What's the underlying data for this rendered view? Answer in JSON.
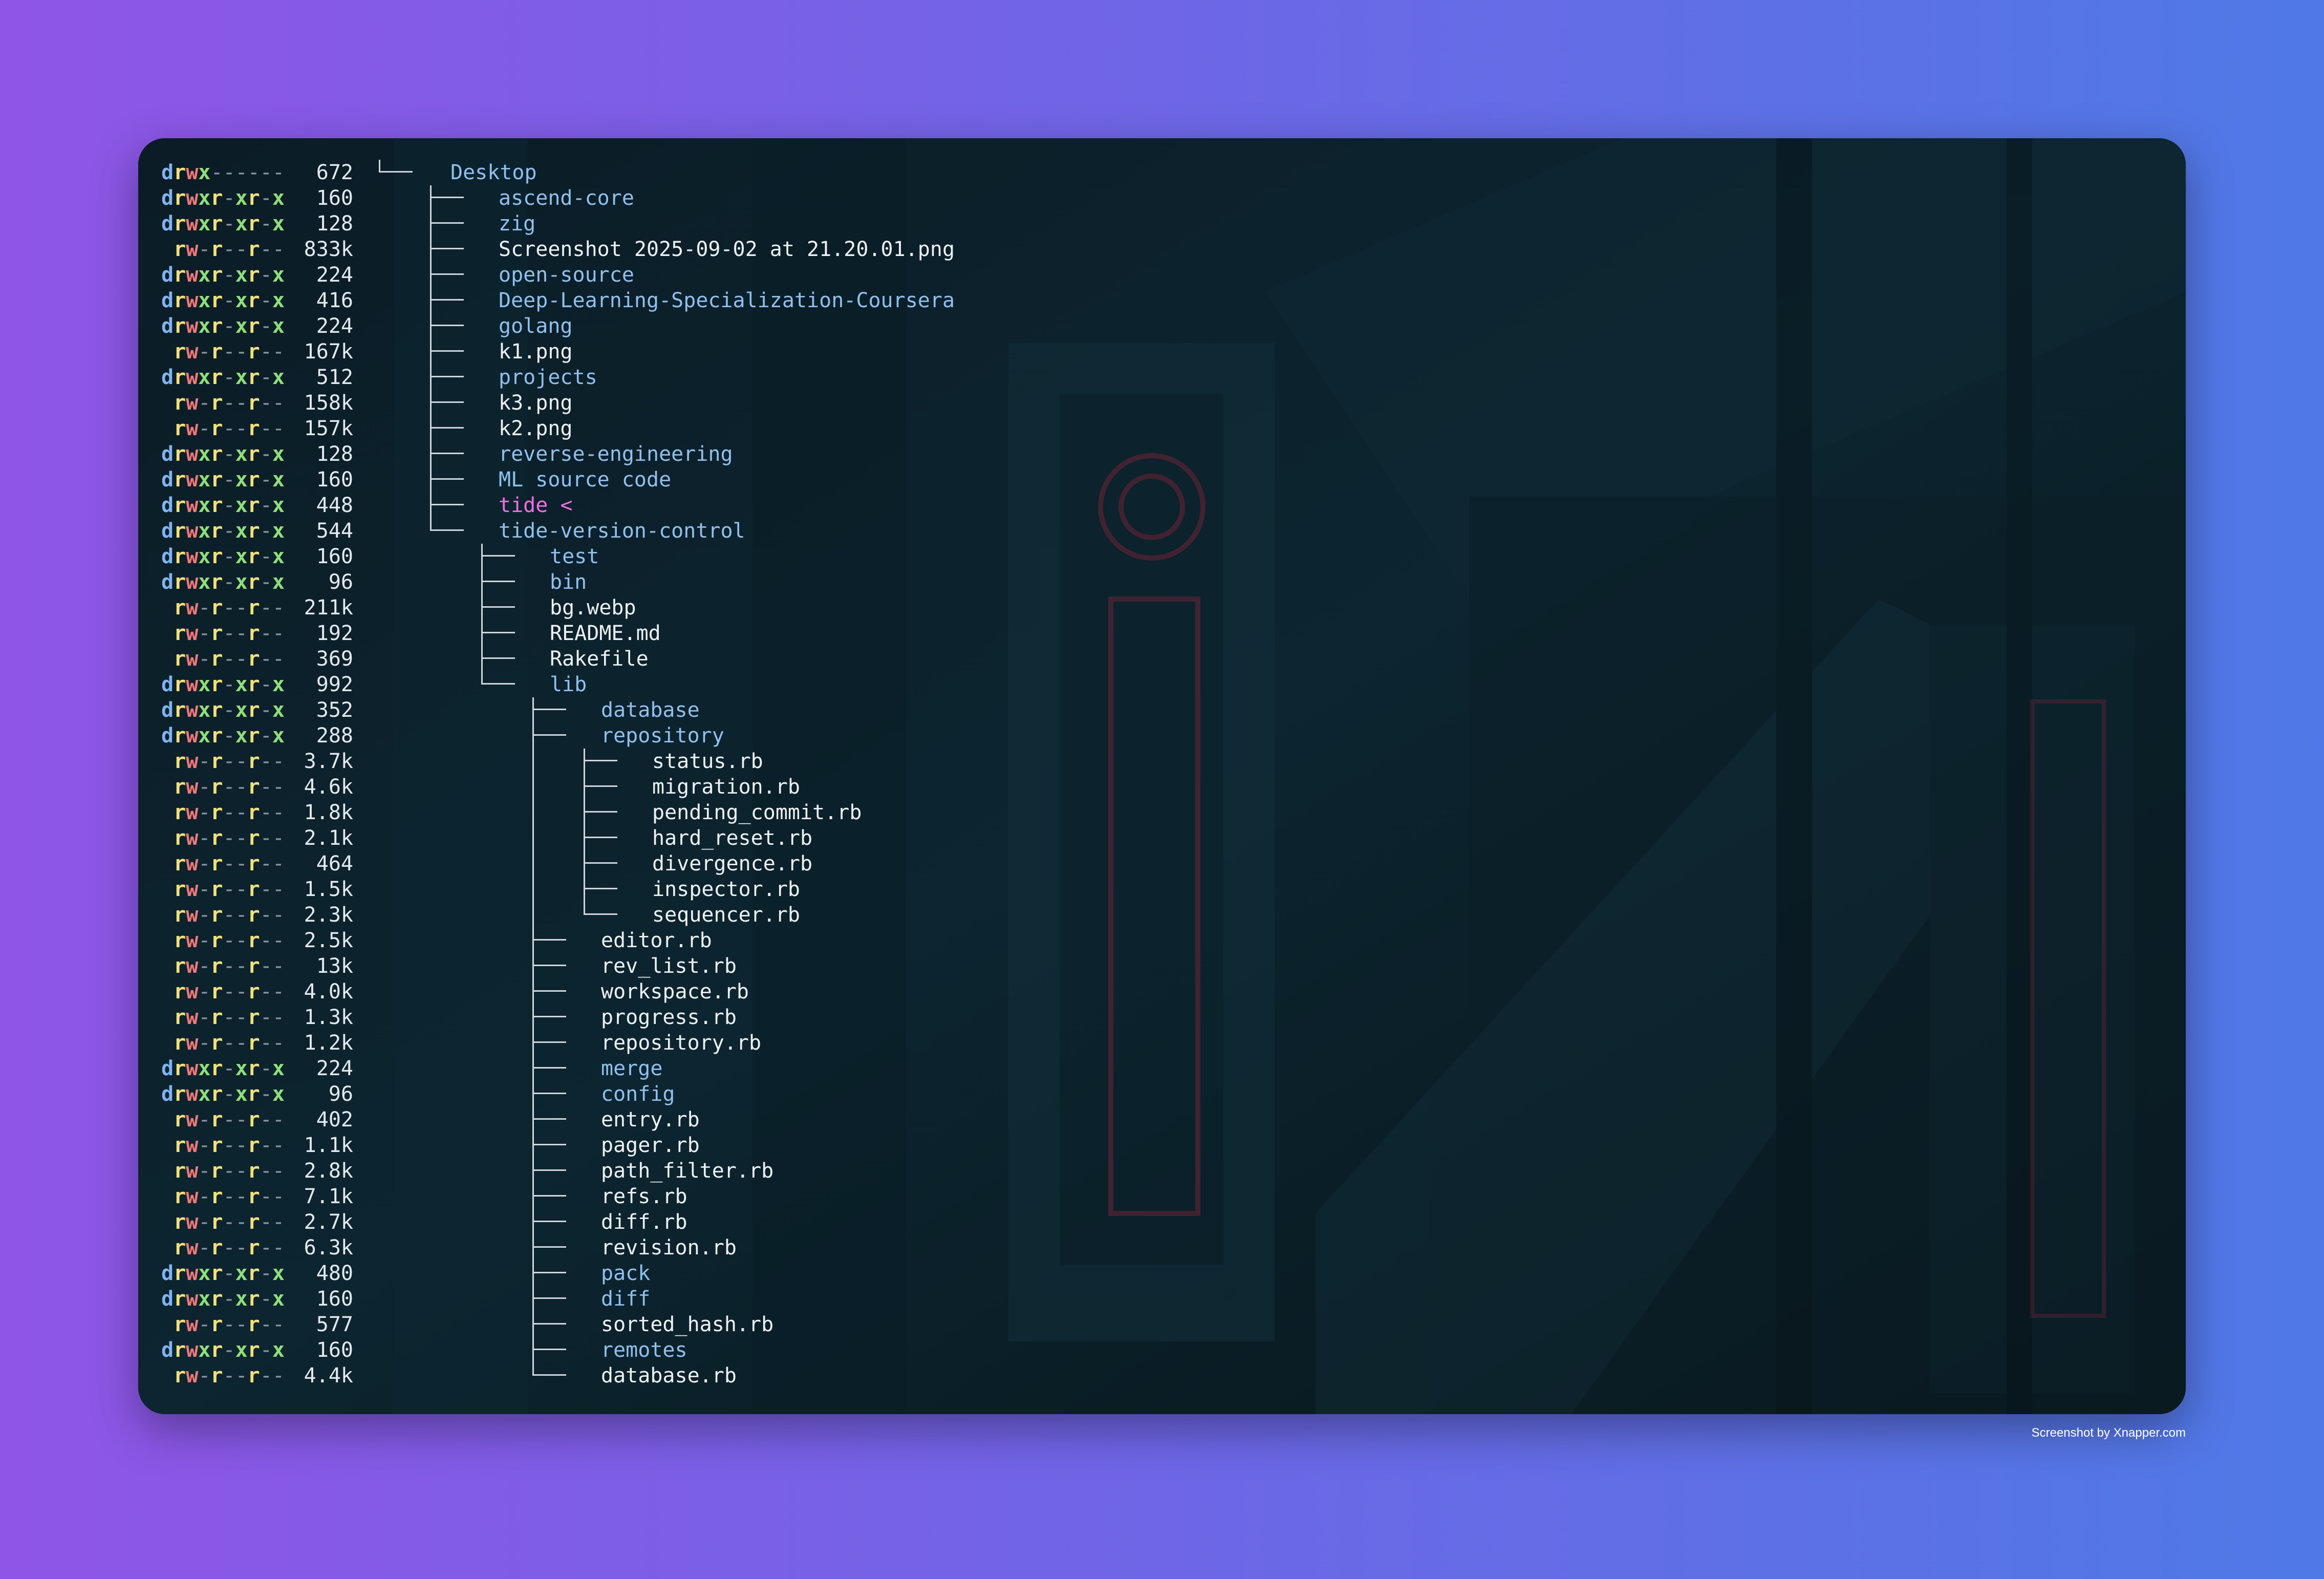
{
  "colors": {
    "gradient_left": "#8f55e6",
    "gradient_right": "#4f79e6",
    "dir": "#8fc0ee",
    "file": "#eef1f4",
    "selected": "#ef70e2",
    "perm_d": "#7fb4f0",
    "perm_r": "#f2e07a",
    "perm_w": "#f07a7a",
    "perm_x": "#8ee07a"
  },
  "caption": "Screenshot by Xnapper.com",
  "listing": [
    {
      "perm": "drwx------",
      "size": "672",
      "name": "Desktop",
      "depth": 0,
      "type": "dir"
    },
    {
      "perm": "drwxr-xr-x",
      "size": "160",
      "name": "ascend-core",
      "depth": 1,
      "type": "dir"
    },
    {
      "perm": "drwxr-xr-x",
      "size": "128",
      "name": "zig",
      "depth": 1,
      "type": "dir"
    },
    {
      "perm": ".rw-r--r--",
      "size": "833k",
      "name": "Screenshot 2025-09-02 at 21.20.01.png",
      "depth": 1,
      "type": "file"
    },
    {
      "perm": "drwxr-xr-x",
      "size": "224",
      "name": "open-source",
      "depth": 1,
      "type": "dir"
    },
    {
      "perm": "drwxr-xr-x",
      "size": "416",
      "name": "Deep-Learning-Specialization-Coursera",
      "depth": 1,
      "type": "dir"
    },
    {
      "perm": "drwxr-xr-x",
      "size": "224",
      "name": "golang",
      "depth": 1,
      "type": "dir"
    },
    {
      "perm": ".rw-r--r--",
      "size": "167k",
      "name": "k1.png",
      "depth": 1,
      "type": "file"
    },
    {
      "perm": "drwxr-xr-x",
      "size": "512",
      "name": "projects",
      "depth": 1,
      "type": "dir"
    },
    {
      "perm": ".rw-r--r--",
      "size": "158k",
      "name": "k3.png",
      "depth": 1,
      "type": "file"
    },
    {
      "perm": ".rw-r--r--",
      "size": "157k",
      "name": "k2.png",
      "depth": 1,
      "type": "file"
    },
    {
      "perm": "drwxr-xr-x",
      "size": "128",
      "name": "reverse-engineering",
      "depth": 1,
      "type": "dir"
    },
    {
      "perm": "drwxr-xr-x",
      "size": "160",
      "name": "ML source code",
      "depth": 1,
      "type": "dir"
    },
    {
      "perm": "drwxr-xr-x",
      "size": "448",
      "name": "tide <",
      "depth": 1,
      "type": "sel"
    },
    {
      "perm": "drwxr-xr-x",
      "size": "544",
      "name": "tide-version-control",
      "depth": 1,
      "type": "dir"
    },
    {
      "perm": "drwxr-xr-x",
      "size": "160",
      "name": "test",
      "depth": 2,
      "type": "dir"
    },
    {
      "perm": "drwxr-xr-x",
      "size": "96",
      "name": "bin",
      "depth": 2,
      "type": "dir"
    },
    {
      "perm": ".rw-r--r--",
      "size": "211k",
      "name": "bg.webp",
      "depth": 2,
      "type": "file"
    },
    {
      "perm": ".rw-r--r--",
      "size": "192",
      "name": "README.md",
      "depth": 2,
      "type": "file"
    },
    {
      "perm": ".rw-r--r--",
      "size": "369",
      "name": "Rakefile",
      "depth": 2,
      "type": "file"
    },
    {
      "perm": "drwxr-xr-x",
      "size": "992",
      "name": "lib",
      "depth": 2,
      "type": "dir"
    },
    {
      "perm": "drwxr-xr-x",
      "size": "352",
      "name": "database",
      "depth": 3,
      "type": "dir"
    },
    {
      "perm": "drwxr-xr-x",
      "size": "288",
      "name": "repository",
      "depth": 3,
      "type": "dir"
    },
    {
      "perm": ".rw-r--r--",
      "size": "3.7k",
      "name": "status.rb",
      "depth": 4,
      "type": "file"
    },
    {
      "perm": ".rw-r--r--",
      "size": "4.6k",
      "name": "migration.rb",
      "depth": 4,
      "type": "file"
    },
    {
      "perm": ".rw-r--r--",
      "size": "1.8k",
      "name": "pending_commit.rb",
      "depth": 4,
      "type": "file"
    },
    {
      "perm": ".rw-r--r--",
      "size": "2.1k",
      "name": "hard_reset.rb",
      "depth": 4,
      "type": "file"
    },
    {
      "perm": ".rw-r--r--",
      "size": "464",
      "name": "divergence.rb",
      "depth": 4,
      "type": "file"
    },
    {
      "perm": ".rw-r--r--",
      "size": "1.5k",
      "name": "inspector.rb",
      "depth": 4,
      "type": "file"
    },
    {
      "perm": ".rw-r--r--",
      "size": "2.3k",
      "name": "sequencer.rb",
      "depth": 4,
      "type": "file"
    },
    {
      "perm": ".rw-r--r--",
      "size": "2.5k",
      "name": "editor.rb",
      "depth": 3,
      "type": "file"
    },
    {
      "perm": ".rw-r--r--",
      "size": "13k",
      "name": "rev_list.rb",
      "depth": 3,
      "type": "file"
    },
    {
      "perm": ".rw-r--r--",
      "size": "4.0k",
      "name": "workspace.rb",
      "depth": 3,
      "type": "file"
    },
    {
      "perm": ".rw-r--r--",
      "size": "1.3k",
      "name": "progress.rb",
      "depth": 3,
      "type": "file"
    },
    {
      "perm": ".rw-r--r--",
      "size": "1.2k",
      "name": "repository.rb",
      "depth": 3,
      "type": "file"
    },
    {
      "perm": "drwxr-xr-x",
      "size": "224",
      "name": "merge",
      "depth": 3,
      "type": "dir"
    },
    {
      "perm": "drwxr-xr-x",
      "size": "96",
      "name": "config",
      "depth": 3,
      "type": "dir"
    },
    {
      "perm": ".rw-r--r--",
      "size": "402",
      "name": "entry.rb",
      "depth": 3,
      "type": "file"
    },
    {
      "perm": ".rw-r--r--",
      "size": "1.1k",
      "name": "pager.rb",
      "depth": 3,
      "type": "file"
    },
    {
      "perm": ".rw-r--r--",
      "size": "2.8k",
      "name": "path_filter.rb",
      "depth": 3,
      "type": "file"
    },
    {
      "perm": ".rw-r--r--",
      "size": "7.1k",
      "name": "refs.rb",
      "depth": 3,
      "type": "file"
    },
    {
      "perm": ".rw-r--r--",
      "size": "2.7k",
      "name": "diff.rb",
      "depth": 3,
      "type": "file"
    },
    {
      "perm": ".rw-r--r--",
      "size": "6.3k",
      "name": "revision.rb",
      "depth": 3,
      "type": "file"
    },
    {
      "perm": "drwxr-xr-x",
      "size": "480",
      "name": "pack",
      "depth": 3,
      "type": "dir"
    },
    {
      "perm": "drwxr-xr-x",
      "size": "160",
      "name": "diff",
      "depth": 3,
      "type": "dir"
    },
    {
      "perm": ".rw-r--r--",
      "size": "577",
      "name": "sorted_hash.rb",
      "depth": 3,
      "type": "file"
    },
    {
      "perm": "drwxr-xr-x",
      "size": "160",
      "name": "remotes",
      "depth": 3,
      "type": "dir"
    },
    {
      "perm": ".rw-r--r--",
      "size": "4.4k",
      "name": "database.rb",
      "depth": 3,
      "type": "file"
    }
  ]
}
